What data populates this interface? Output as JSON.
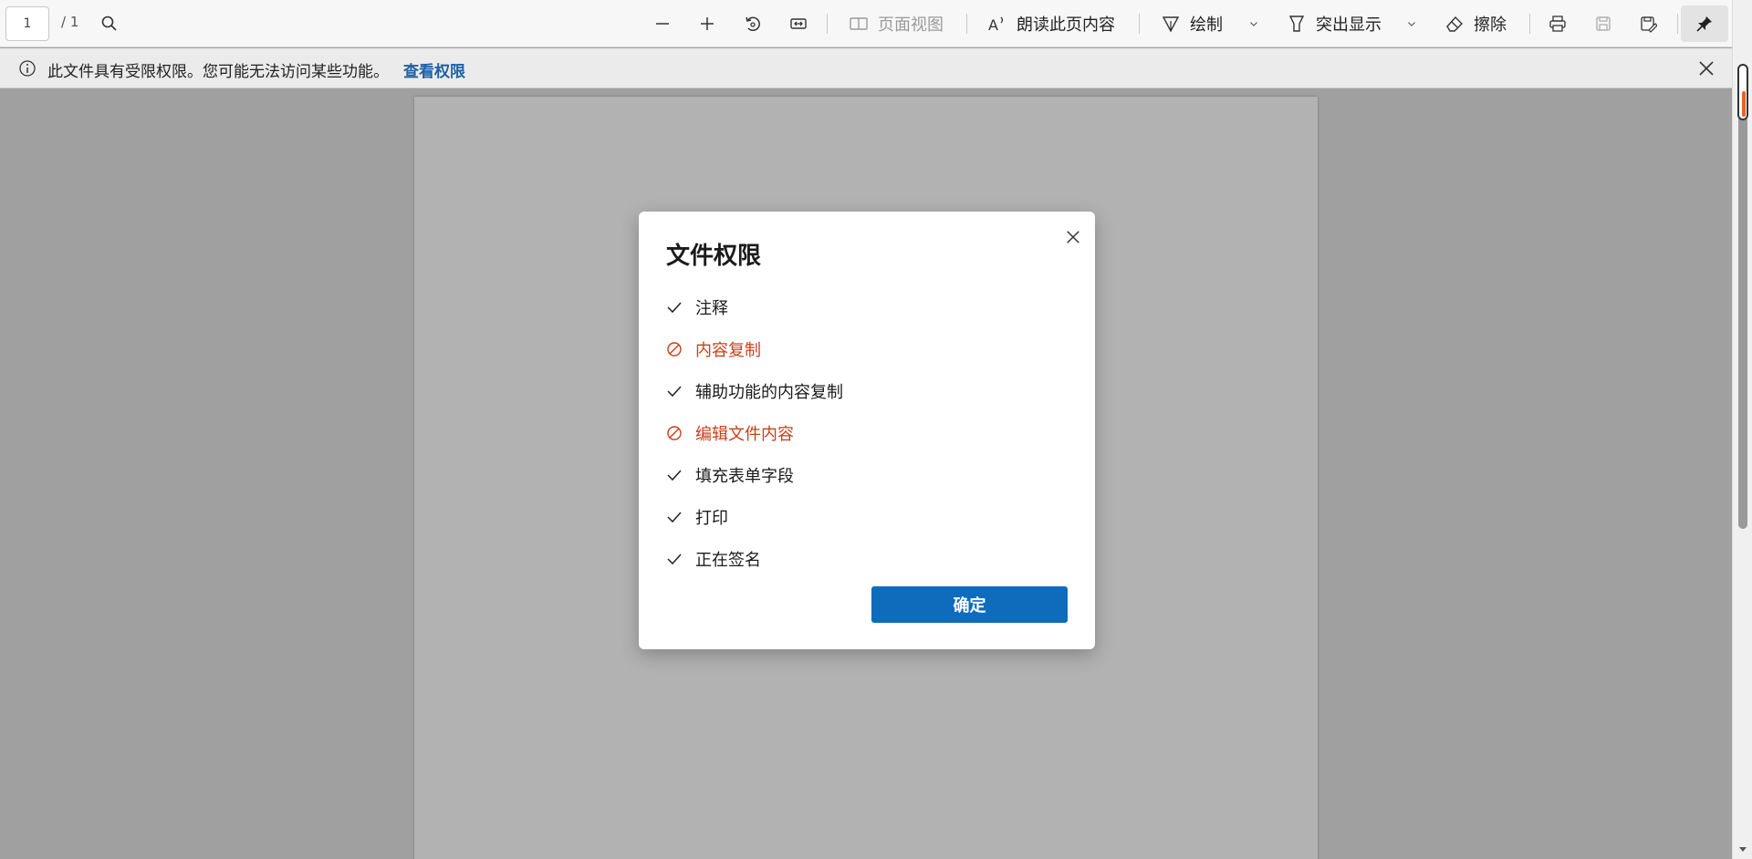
{
  "toolbar": {
    "page_current": "1",
    "page_total": "/ 1",
    "page_view_label": "页面视图",
    "read_aloud_label": "朗读此页内容",
    "draw_label": "绘制",
    "highlight_label": "突出显示",
    "erase_label": "擦除"
  },
  "infobar": {
    "message": "此文件具有受限权限。您可能无法访问某些功能。",
    "link": "查看权限"
  },
  "dialog": {
    "title": "文件权限",
    "ok_label": "确定",
    "permissions": [
      {
        "label": "注释",
        "allowed": true
      },
      {
        "label": "内容复制",
        "allowed": false
      },
      {
        "label": "辅助功能的内容复制",
        "allowed": true
      },
      {
        "label": "编辑文件内容",
        "allowed": false
      },
      {
        "label": "填充表单字段",
        "allowed": true
      },
      {
        "label": "打印",
        "allowed": true
      },
      {
        "label": "正在签名",
        "allowed": true
      }
    ]
  },
  "colors": {
    "accent": "#0f6cbd",
    "denied": "#c8401a",
    "link": "#1f5fa6"
  }
}
